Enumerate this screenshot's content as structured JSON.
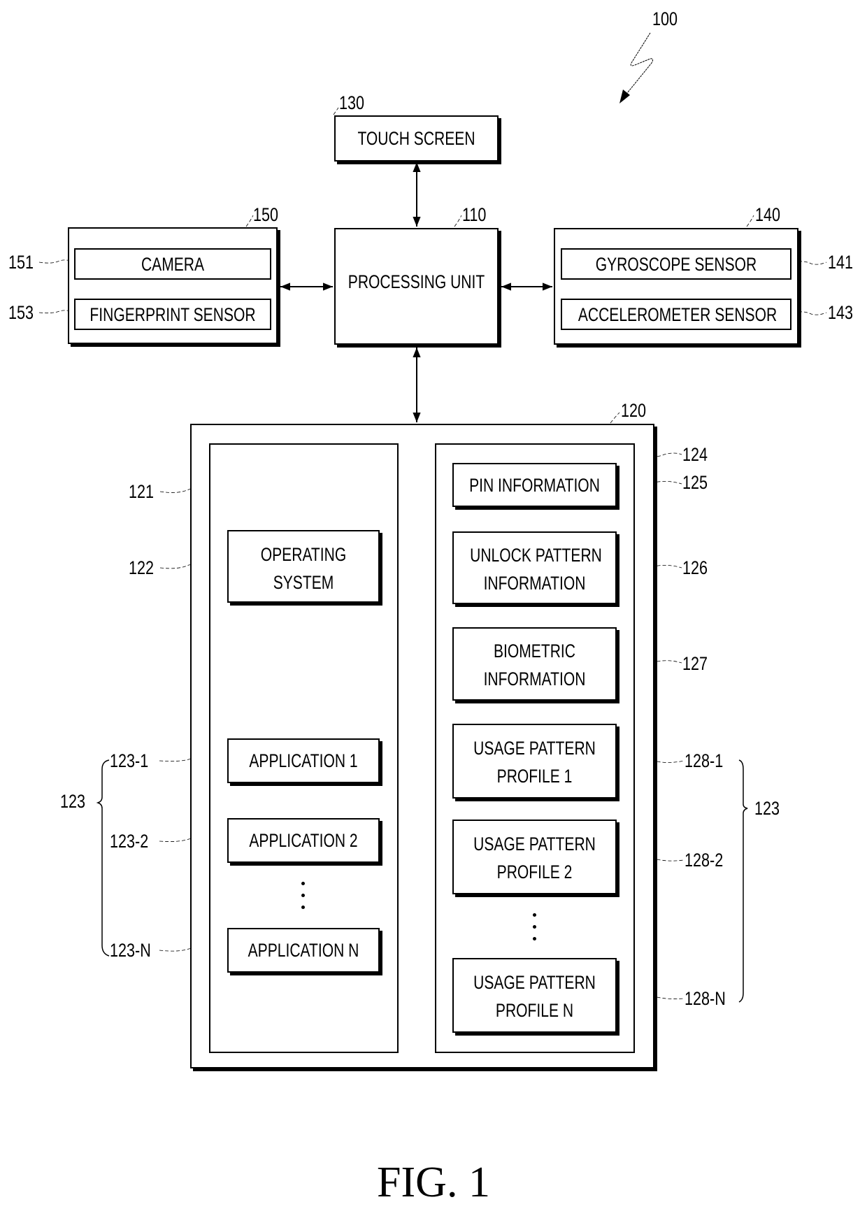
{
  "figure": {
    "caption": "FIG. 1",
    "system_ref": "100"
  },
  "blocks": {
    "touch_screen": {
      "label": "TOUCH SCREEN",
      "ref": "130"
    },
    "processing_unit": {
      "label": "PROCESSING UNIT",
      "ref": "110"
    },
    "module_150": {
      "ref": "150",
      "items": [
        {
          "label": "CAMERA",
          "ref": "151"
        },
        {
          "label": "FINGERPRINT SENSOR",
          "ref": "153"
        }
      ]
    },
    "module_140": {
      "ref": "140",
      "items": [
        {
          "label": "GYROSCOPE SENSOR",
          "ref": "141"
        },
        {
          "label": "ACCELEROMETER SENSOR",
          "ref": "143"
        }
      ]
    },
    "memory": {
      "ref": "120",
      "left_panel": {
        "ref": "121",
        "os": {
          "line1": "OPERATING",
          "line2": "SYSTEM",
          "ref": "122"
        },
        "apps": [
          {
            "label": "APPLICATION 1",
            "ref": "123-1"
          },
          {
            "label": "APPLICATION 2",
            "ref": "123-2"
          },
          {
            "label": "APPLICATION N",
            "ref": "123-N"
          }
        ],
        "group_ref": "123"
      },
      "right_panel": {
        "ref": "124",
        "pin": {
          "label": "PIN INFORMATION",
          "ref": "125"
        },
        "unlock": {
          "line1": "UNLOCK PATTERN",
          "line2": "INFORMATION",
          "ref": "126"
        },
        "biometric": {
          "line1": "BIOMETRIC",
          "line2": "INFORMATION",
          "ref": "127"
        },
        "profiles": [
          {
            "line1": "USAGE PATTERN",
            "line2": "PROFILE 1",
            "ref": "128-1"
          },
          {
            "line1": "USAGE PATTERN",
            "line2": "PROFILE 2",
            "ref": "128-2"
          },
          {
            "line1": "USAGE PATTERN",
            "line2": "PROFILE N",
            "ref": "128-N"
          }
        ],
        "group_ref": "123"
      }
    }
  }
}
